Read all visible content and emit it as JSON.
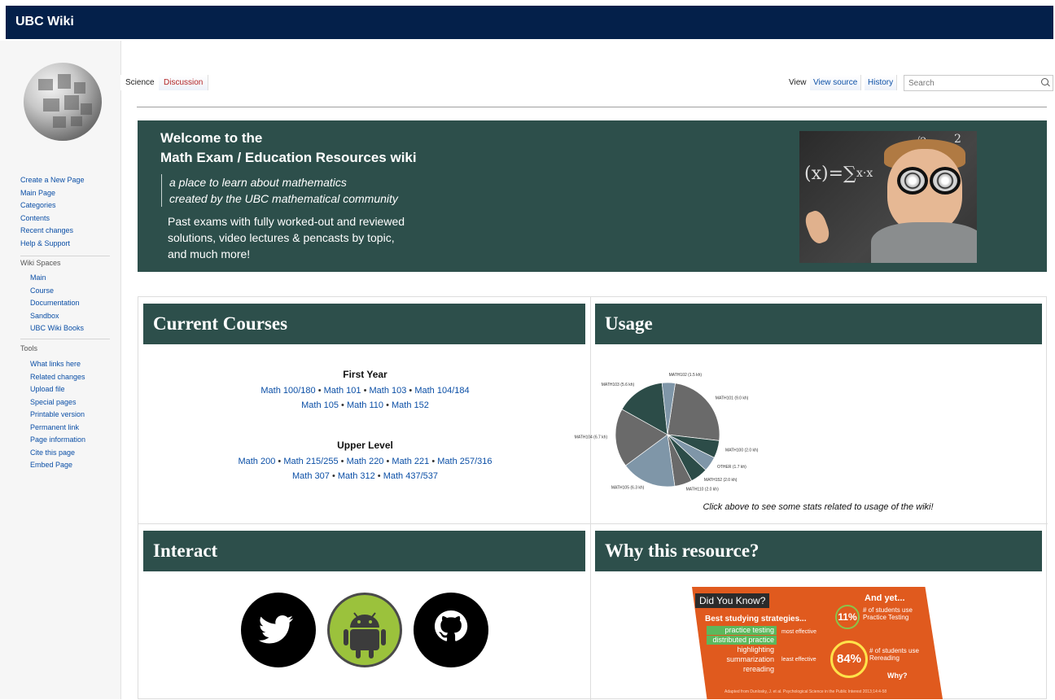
{
  "app": {
    "brand": "UBC Wiki"
  },
  "sidebar": {
    "nav": [
      "Create a New Page",
      "Main Page",
      "Categories",
      "Contents",
      "Recent changes",
      "Help & Support"
    ],
    "spaces_heading": "Wiki Spaces",
    "spaces": [
      "Main",
      "Course",
      "Documentation",
      "Sandbox",
      "UBC Wiki Books"
    ],
    "tools_heading": "Tools",
    "tools": [
      "What links here",
      "Related changes",
      "Upload file",
      "Special pages",
      "Printable version",
      "Permanent link",
      "Page information",
      "Cite this page",
      "Embed Page"
    ]
  },
  "tabs": {
    "science": "Science",
    "discussion": "Discussion",
    "view": "View",
    "view_source": "View source",
    "history": "History",
    "search_placeholder": "Search"
  },
  "banner": {
    "title_line1": "Welcome to the",
    "title_line2": "Math Exam / Education Resources wiki",
    "tagline1": "a place to learn about mathematics",
    "tagline2": "created by the UBC mathematical community",
    "desc1": "Past exams with fully worked-out and reviewed",
    "desc2": "solutions, video lectures & pencasts by topic,",
    "desc3": "and much more!"
  },
  "courses": {
    "heading": "Current Courses",
    "first_year_label": "First Year",
    "first_year_row1": [
      "Math 100/180",
      "Math 101",
      "Math 103",
      "Math 104/184"
    ],
    "first_year_row2": [
      "Math 105",
      "Math 110",
      "Math 152"
    ],
    "upper_label": "Upper Level",
    "upper_row1": [
      "Math 200",
      "Math 215/255",
      "Math 220",
      "Math 221",
      "Math 257/316"
    ],
    "upper_row2": [
      "Math 307",
      "Math 312",
      "Math 437/537"
    ],
    "separator": "•"
  },
  "usage": {
    "heading": "Usage",
    "caption": "Click above to see some stats related to usage of the wiki!",
    "pie": [
      {
        "label": "MATH101 (9.0 kh)",
        "value": 9.0,
        "color": "#6a6a6a"
      },
      {
        "label": "MATH100 (2.0 kh)",
        "value": 2.0,
        "color": "#2c4c48"
      },
      {
        "label": "OTHER (1.7 kh)",
        "value": 1.7,
        "color": "#7f96a8"
      },
      {
        "label": "MATH152 (2.0 kh)",
        "value": 2.0,
        "color": "#2c4c48"
      },
      {
        "label": "MATH110 (2.0 kh)",
        "value": 2.0,
        "color": "#6a6a6a"
      },
      {
        "label": "MATH105 (6.3 kh)",
        "value": 6.3,
        "color": "#7f96a8"
      },
      {
        "label": "MATH104 (6.7 kh)",
        "value": 6.7,
        "color": "#6a6a6a"
      },
      {
        "label": "MATH103 (5.6 kh)",
        "value": 5.6,
        "color": "#2c4c48"
      },
      {
        "label": "MATH102 (1.5 kh)",
        "value": 1.5,
        "color": "#7f96a8"
      }
    ]
  },
  "interact": {
    "heading": "Interact",
    "colors": {
      "twitter": "#000000",
      "android": "#9bc23c",
      "github": "#000000"
    }
  },
  "why": {
    "heading": "Why this resource?",
    "did_you_know": "Did You Know?",
    "best": "Best studying strategies...",
    "strategies": [
      "practice testing",
      "distributed practice",
      "highlighting",
      "summarization",
      "rereading"
    ],
    "most_effective": "most effective",
    "least_effective": "least effective",
    "and_yet": "And yet...",
    "pct_practice": "11%",
    "pct_practice_label": "# of students use Practice Testing",
    "pct_reread": "84%",
    "pct_reread_label": "# of students use Rereading",
    "why": "Why?",
    "footnote": "Adapted from Dunlosky, J. et al. Psychological Science in the Public Interest 2013;14:4-58"
  }
}
